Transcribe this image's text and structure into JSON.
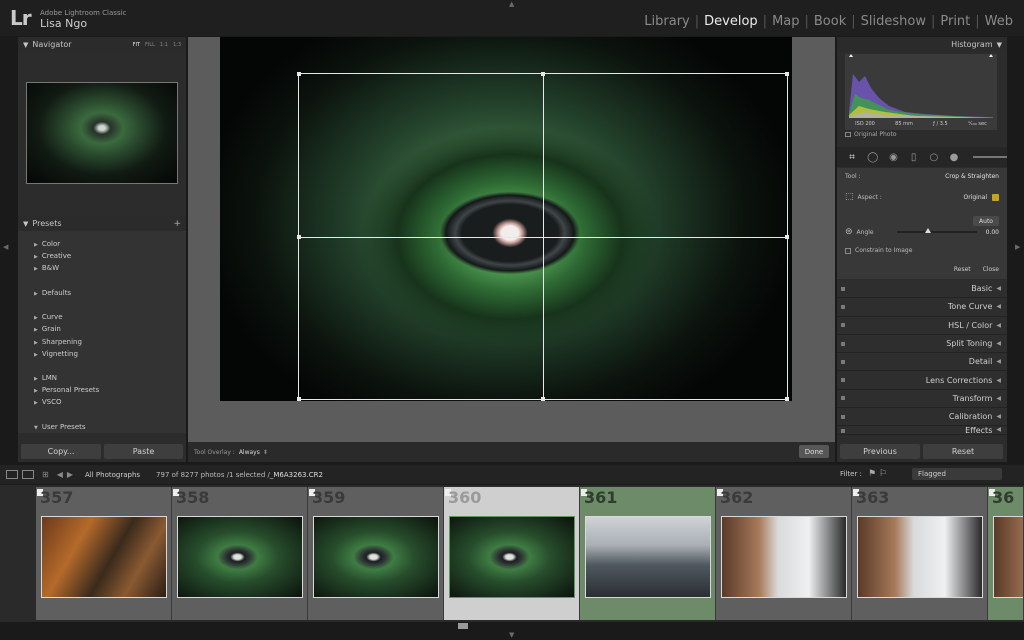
{
  "app": {
    "logo": "Lr",
    "name": "Adobe Lightroom Classic",
    "user": "Lisa Ngo"
  },
  "modules": [
    "Library",
    "Develop",
    "Map",
    "Book",
    "Slideshow",
    "Print",
    "Web"
  ],
  "active_module": "Develop",
  "navigator": {
    "title": "Navigator",
    "zoom_options": [
      "FIT",
      "FILL",
      "1:1",
      "1:3"
    ],
    "active_zoom": "FIT"
  },
  "presets": {
    "title": "Presets",
    "add": "+",
    "groups": [
      [
        "Color",
        "Creative",
        "B&W"
      ],
      [
        "Defaults"
      ],
      [
        "Curve",
        "Grain",
        "Sharpening",
        "Vignetting"
      ],
      [
        "LMN",
        "Personal Presets",
        "VSCO"
      ],
      [
        "User Presets"
      ]
    ]
  },
  "left_buttons": {
    "copy": "Copy...",
    "paste": "Paste"
  },
  "toolbar": {
    "overlay_label": "Tool Overlay :",
    "overlay_value": "Always",
    "done": "Done"
  },
  "histogram": {
    "title": "Histogram",
    "iso": "ISO 200",
    "focal": "85 mm",
    "aperture": "ƒ / 3.5",
    "shutter": "¹⁄₁₀₀ sec",
    "original_photo": "Original Photo"
  },
  "crop_tool": {
    "tool_label": "Tool :",
    "tool_name": "Crop & Straighten",
    "aspect_label": "Aspect :",
    "aspect_value": "Original",
    "auto": "Auto",
    "angle_label": "Angle",
    "angle_value": "0.00",
    "constrain": "Constrain to Image",
    "reset": "Reset",
    "close": "Close"
  },
  "sections": [
    "Basic",
    "Tone Curve",
    "HSL / Color",
    "Split Toning",
    "Detail",
    "Lens Corrections",
    "Transform",
    "Calibration",
    "Effects"
  ],
  "right_buttons": {
    "previous": "Previous",
    "reset": "Reset"
  },
  "filmstrip_bar": {
    "source": "All Photographs",
    "count": "797 of 8277 photos /1 selected /",
    "file": "_M6A3263.CR2",
    "filter_label": "Filter :",
    "filter_value": "Flagged"
  },
  "filmstrip": {
    "cells": [
      {
        "num": "357",
        "thumb": "party"
      },
      {
        "num": "358",
        "thumb": "succ"
      },
      {
        "num": "359",
        "thumb": "succ"
      },
      {
        "num": "360",
        "thumb": "succ"
      },
      {
        "num": "361",
        "thumb": "wedding"
      },
      {
        "num": "362",
        "thumb": "window"
      },
      {
        "num": "363",
        "thumb": "window"
      },
      {
        "num": "36",
        "thumb": "window"
      }
    ],
    "selected": "360"
  },
  "colors": {
    "accent": "#ececec",
    "panel": "#2c2c2c",
    "workspace": "#5c5c5c",
    "selected_cell": "#cfcfcf",
    "flag_green": "#6d8a69",
    "lock": "#c7a12b"
  }
}
